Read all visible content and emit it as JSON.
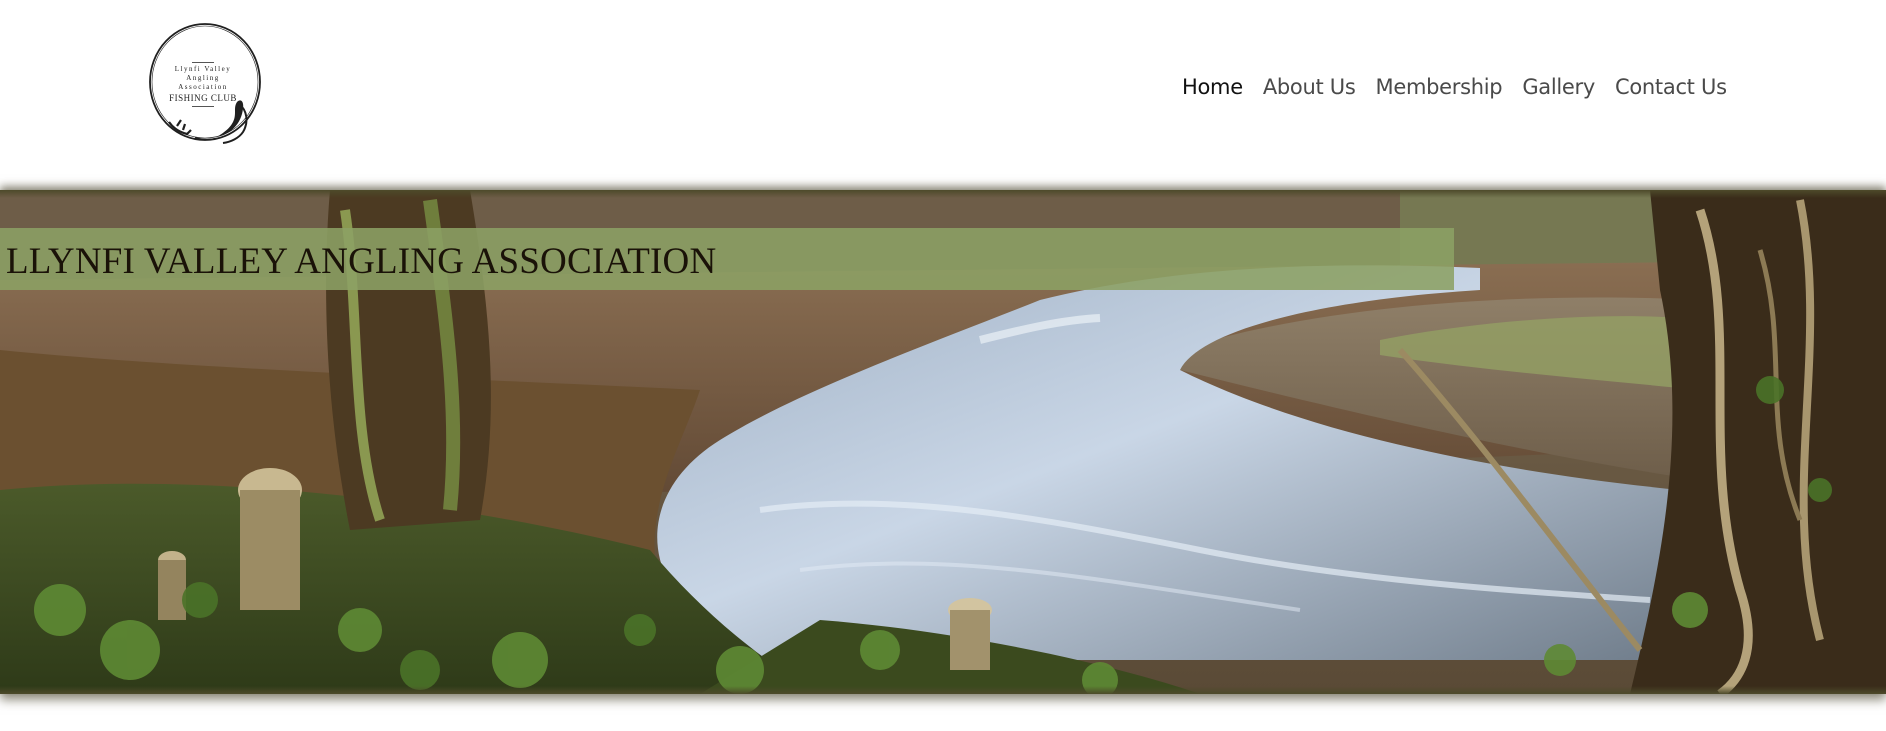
{
  "logo": {
    "line1": "Llynfi Valley",
    "line2": "Angling",
    "line3": "Association",
    "line4": "FISHING CLUB"
  },
  "nav": {
    "items": [
      {
        "label": "Home",
        "active": true
      },
      {
        "label": "About Us",
        "active": false
      },
      {
        "label": "Membership",
        "active": false
      },
      {
        "label": "Gallery",
        "active": false
      },
      {
        "label": "Contact Us",
        "active": false
      }
    ]
  },
  "hero": {
    "title": "LLYNFI VALLEY ANGLING ASSOCIATION"
  },
  "colors": {
    "title_band": "#8ca064",
    "title_text": "#1a1208",
    "nav_text": "#4a4a4a",
    "nav_active": "#111111"
  }
}
